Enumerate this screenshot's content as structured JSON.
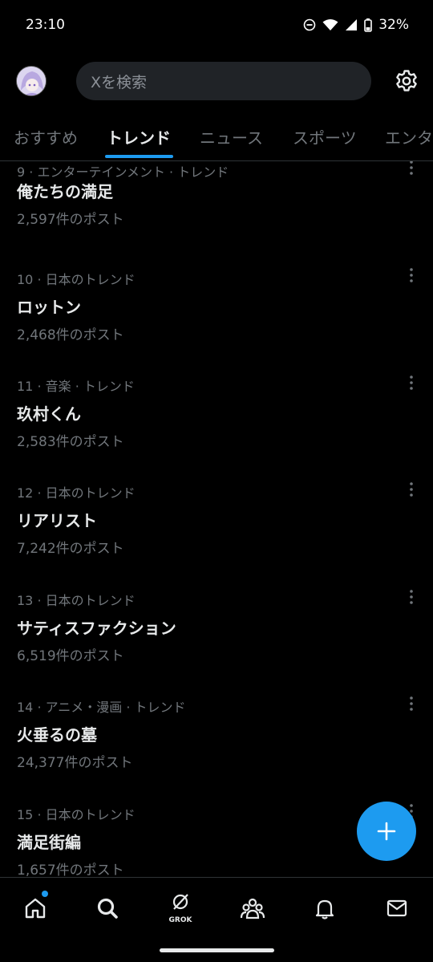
{
  "status_bar": {
    "time": "23:10",
    "battery": "32%"
  },
  "search": {
    "placeholder": "Xを検索"
  },
  "tabs": [
    {
      "label": "おすすめ",
      "active": false
    },
    {
      "label": "トレンド",
      "active": true
    },
    {
      "label": "ニュース",
      "active": false
    },
    {
      "label": "スポーツ",
      "active": false
    },
    {
      "label": "エンタ",
      "active": false
    }
  ],
  "trends": [
    {
      "meta": "9 · エンターテインメント · トレンド",
      "name": "俺たちの満足",
      "count": "2,597件のポスト"
    },
    {
      "meta": "10 · 日本のトレンド",
      "name": "ロットン",
      "count": "2,468件のポスト"
    },
    {
      "meta": "11 · 音楽 · トレンド",
      "name": "玖村くん",
      "count": "2,583件のポスト"
    },
    {
      "meta": "12 · 日本のトレンド",
      "name": "リアリスト",
      "count": "7,242件のポスト"
    },
    {
      "meta": "13 · 日本のトレンド",
      "name": "サティスファクション",
      "count": "6,519件のポスト"
    },
    {
      "meta": "14 · アニメ・漫画 · トレンド",
      "name": "火垂るの墓",
      "count": "24,377件のポスト"
    },
    {
      "meta": "15 · 日本のトレンド",
      "name": "満足街編",
      "count": "1,657件のポスト"
    }
  ],
  "bottom_nav": {
    "items": [
      {
        "icon": "home-icon",
        "notification_dot": true
      },
      {
        "icon": "search-icon"
      },
      {
        "icon": "grok-icon",
        "label": "GROK"
      },
      {
        "icon": "communities-icon"
      },
      {
        "icon": "notifications-icon"
      },
      {
        "icon": "messages-icon"
      }
    ]
  },
  "colors": {
    "accent": "#1d9bf0",
    "background": "#000000",
    "text_primary": "#e7e9ea",
    "text_secondary": "#71767b"
  }
}
